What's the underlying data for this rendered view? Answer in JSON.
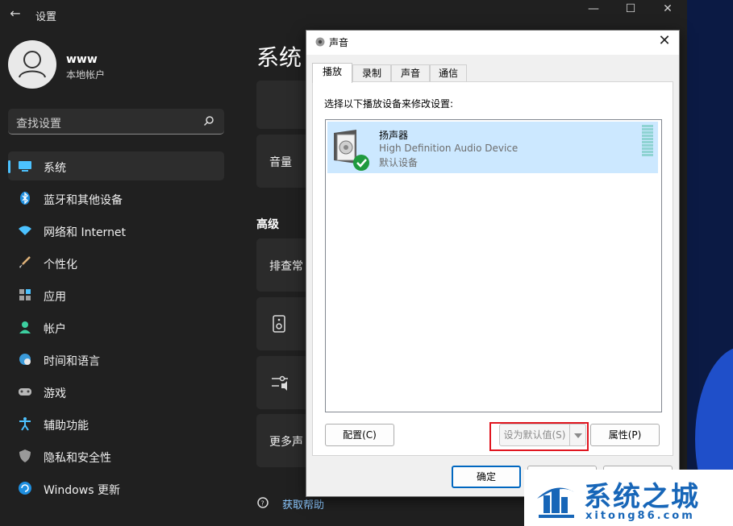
{
  "settings": {
    "title": "设置",
    "user": {
      "name": "www",
      "account_type": "本地帐户"
    },
    "search_placeholder": "查找设置",
    "nav": [
      {
        "label": "系统",
        "icon": "monitor-icon",
        "active": true
      },
      {
        "label": "蓝牙和其他设备",
        "icon": "bluetooth-icon"
      },
      {
        "label": "网络和 Internet",
        "icon": "wifi-icon"
      },
      {
        "label": "个性化",
        "icon": "brush-icon"
      },
      {
        "label": "应用",
        "icon": "apps-icon"
      },
      {
        "label": "帐户",
        "icon": "person-icon"
      },
      {
        "label": "时间和语言",
        "icon": "globe-clock-icon"
      },
      {
        "label": "游戏",
        "icon": "gamepad-icon"
      },
      {
        "label": "辅助功能",
        "icon": "accessibility-icon"
      },
      {
        "label": "隐私和安全性",
        "icon": "shield-icon"
      },
      {
        "label": "Windows 更新",
        "icon": "update-icon"
      }
    ],
    "page_title": "系统",
    "volume_label": "音量",
    "advanced_header": "高级",
    "troubleshoot_label": "排查常",
    "more_sound_label": "更多声",
    "help_link": "获取帮助"
  },
  "sound_dialog": {
    "title": "声音",
    "close": "✕",
    "tabs": [
      "播放",
      "录制",
      "声音",
      "通信"
    ],
    "active_tab": 0,
    "instruction": "选择以下播放设备来修改设置:",
    "devices": [
      {
        "name": "扬声器",
        "description": "High Definition Audio Device",
        "status": "默认设备",
        "selected": true
      }
    ],
    "buttons": {
      "configure": "配置(C)",
      "set_default": "设为默认值(S)",
      "properties": "属性(P)",
      "ok": "确定"
    }
  },
  "watermark": {
    "title": "系统之城",
    "url": "xitong86.com"
  },
  "colors": {
    "accent": "#4cc2ff",
    "highlight_box": "#e0141e",
    "selection": "#cce8ff",
    "watermark_blue": "#1766b8"
  }
}
